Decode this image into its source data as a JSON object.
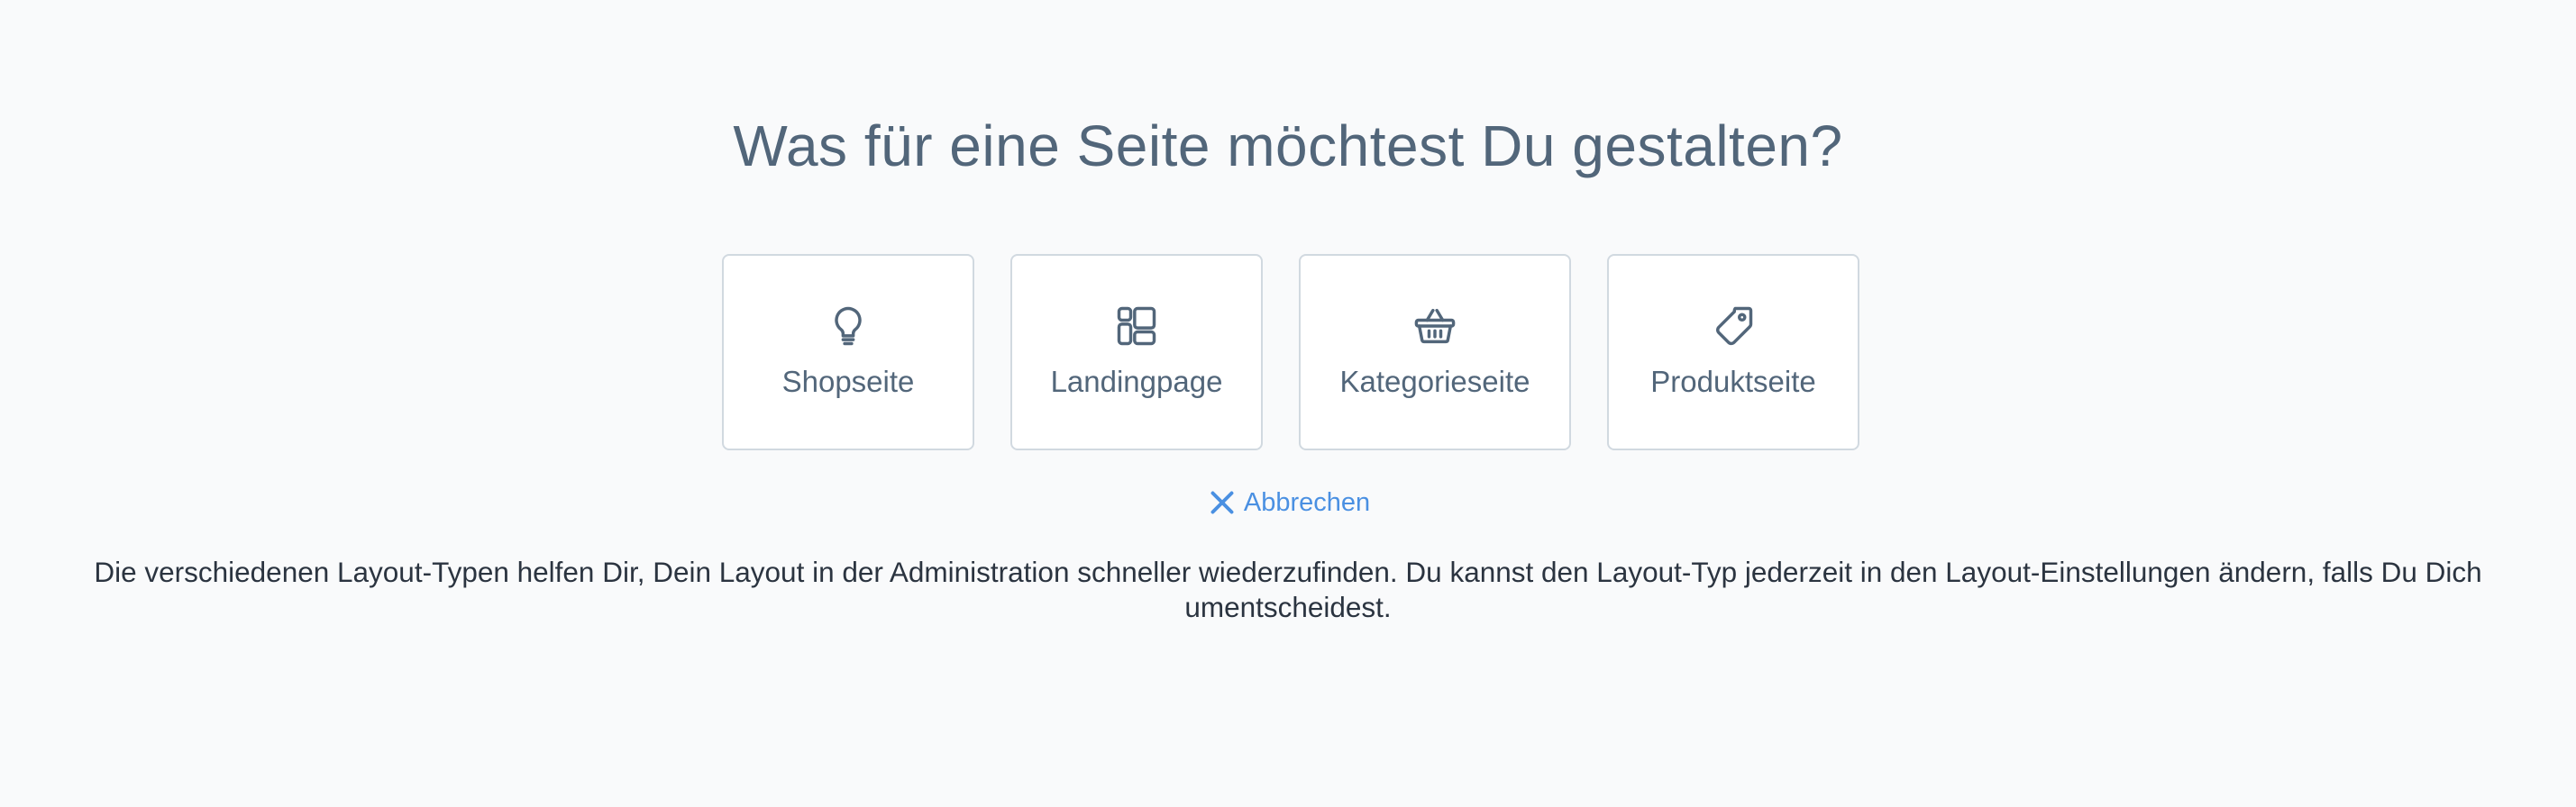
{
  "title": "Was für eine Seite möchtest Du gestalten?",
  "options": [
    {
      "label": "Shopseite",
      "icon": "lightbulb-icon"
    },
    {
      "label": "Landingpage",
      "icon": "layout-grid-icon"
    },
    {
      "label": "Kategorieseite",
      "icon": "basket-icon"
    },
    {
      "label": "Produktseite",
      "icon": "tag-icon"
    }
  ],
  "cancel": {
    "label": "Abbrechen",
    "icon": "close-icon"
  },
  "info": "Die verschiedenen Layout-Typen helfen Dir, Dein Layout in der Administration schneller wiederzufinden. Du kannst den Layout-Typ jederzeit in den Layout-Einstellungen ändern, falls Du Dich umentscheidest.",
  "colors": {
    "background": "#f9fafb",
    "text_muted": "#52667a",
    "text_dark": "#2b3440",
    "accent": "#4a90e2",
    "card_border": "#d1d9e0"
  }
}
